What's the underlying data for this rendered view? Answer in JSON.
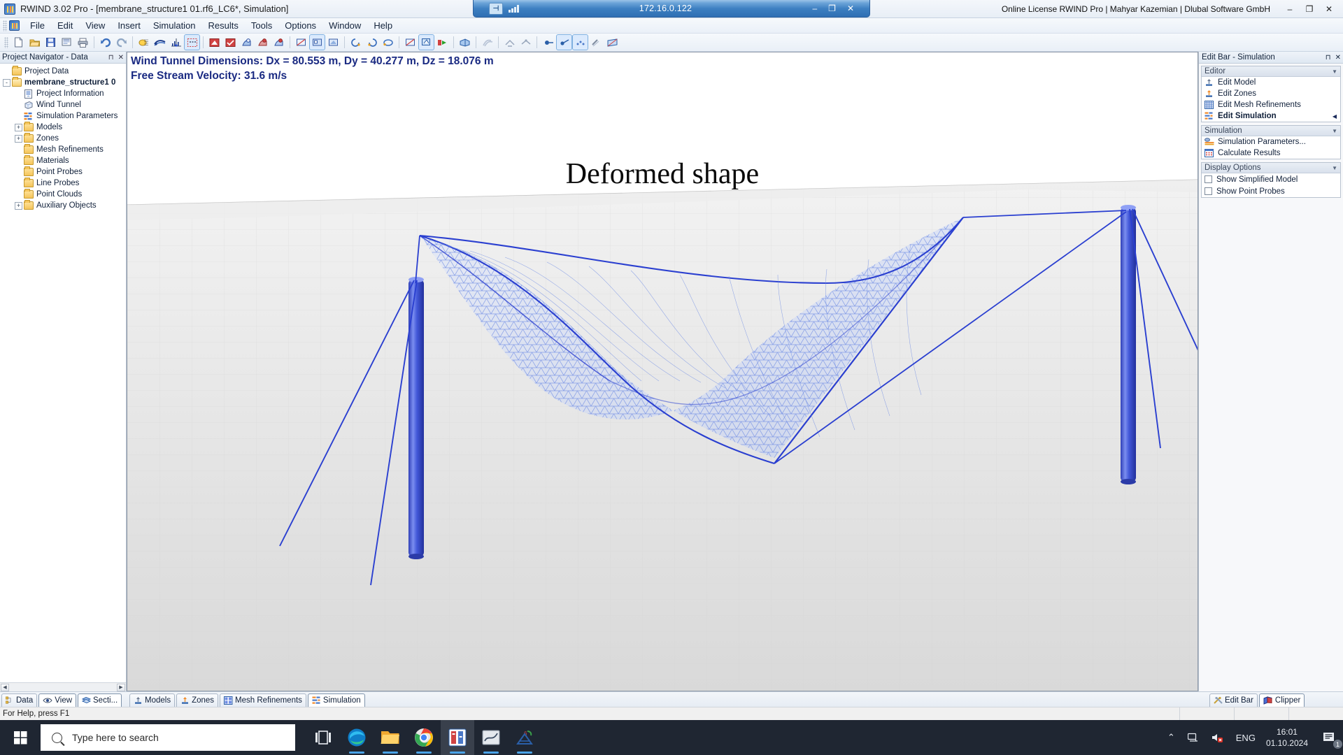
{
  "rdp": {
    "address": "172.16.0.122",
    "pin_icon": "pin-icon",
    "signal_icon": "signal-bars-icon",
    "minimize": "–",
    "restore": "❐",
    "close": "✕"
  },
  "titlebar": {
    "app_icon": "rwind-app-icon",
    "title": "RWIND 3.02 Pro - [membrane_structure1 01.rf6_LC6*, Simulation]",
    "license": "Online License RWIND Pro | Mahyar Kazemian | Dlubal Software GmbH",
    "minimize": "–",
    "restore": "❐",
    "close": "✕"
  },
  "menubar": {
    "items": [
      {
        "label": "File"
      },
      {
        "label": "Edit"
      },
      {
        "label": "View"
      },
      {
        "label": "Insert"
      },
      {
        "label": "Simulation"
      },
      {
        "label": "Results"
      },
      {
        "label": "Tools"
      },
      {
        "label": "Options"
      },
      {
        "label": "Window"
      },
      {
        "label": "Help"
      }
    ]
  },
  "toolbar": {
    "groups": [
      {
        "icons": [
          "new-file-icon",
          "open-folder-icon",
          "save-icon",
          "save-as-icon",
          "print-icon"
        ]
      },
      {
        "icons": [
          "undo-icon",
          "redo-icon"
        ]
      },
      {
        "icons": [
          "mesh-generate-icon",
          "wind-tunnel-icon",
          "axes-icon",
          "selection-box-icon"
        ]
      },
      {
        "icons": [
          "model-view-icon",
          "zones-view-icon",
          "results-view-icon",
          "results-red-icon",
          "results-blue-icon"
        ]
      },
      {
        "icons": [
          "render-wire-icon",
          "render-solid-icon",
          "render-shaded-icon"
        ]
      },
      {
        "icons": [
          "rotate-left-icon",
          "rotate-right-icon",
          "rotate-3d-icon"
        ]
      },
      {
        "icons": [
          "zoom-window-icon",
          "zoom-fit-icon",
          "run-simulation-icon"
        ]
      },
      {
        "icons": [
          "clipper-icon"
        ]
      },
      {
        "icons": [
          "streamlines-icon"
        ]
      },
      {
        "icons": [
          "isosurface-icon",
          "section-plane-icon"
        ]
      },
      {
        "icons": [
          "probe-point-icon",
          "probe-line-icon",
          "probe-cloud-icon",
          "measure-icon",
          "deform-icon"
        ]
      }
    ]
  },
  "navigator": {
    "title": "Project Navigator - Data",
    "pin_icon": "pin-icon",
    "close_icon": "close-icon",
    "tree": [
      {
        "label": "Project Data",
        "depth": 0,
        "expander": "",
        "icon": "folder-icon",
        "bold": false
      },
      {
        "label": "membrane_structure1 0",
        "depth": 0,
        "expander": "-",
        "icon": "folder-open-icon",
        "bold": true
      },
      {
        "label": "Project Information",
        "depth": 1,
        "expander": "",
        "icon": "document-info-icon",
        "bold": false
      },
      {
        "label": "Wind Tunnel",
        "depth": 1,
        "expander": "",
        "icon": "wind-tunnel-icon",
        "bold": false
      },
      {
        "label": "Simulation Parameters",
        "depth": 1,
        "expander": "",
        "icon": "simulation-params-icon",
        "bold": false
      },
      {
        "label": "Models",
        "depth": 1,
        "expander": "+",
        "icon": "folder-icon",
        "bold": false
      },
      {
        "label": "Zones",
        "depth": 1,
        "expander": "+",
        "icon": "folder-icon",
        "bold": false
      },
      {
        "label": "Mesh Refinements",
        "depth": 1,
        "expander": "",
        "icon": "folder-icon",
        "bold": false
      },
      {
        "label": "Materials",
        "depth": 1,
        "expander": "",
        "icon": "folder-icon",
        "bold": false
      },
      {
        "label": "Point Probes",
        "depth": 1,
        "expander": "",
        "icon": "folder-icon",
        "bold": false
      },
      {
        "label": "Line Probes",
        "depth": 1,
        "expander": "",
        "icon": "folder-icon",
        "bold": false
      },
      {
        "label": "Point Clouds",
        "depth": 1,
        "expander": "",
        "icon": "folder-icon",
        "bold": false
      },
      {
        "label": "Auxiliary Objects",
        "depth": 1,
        "expander": "+",
        "icon": "folder-icon",
        "bold": false
      }
    ],
    "tabs": [
      {
        "label": "Data",
        "icon": "data-tree-icon",
        "selected": false
      },
      {
        "label": "View",
        "icon": "eye-icon",
        "selected": true
      },
      {
        "label": "Secti...",
        "icon": "sections-icon",
        "selected": true
      }
    ]
  },
  "viewport": {
    "info_line1": "Wind Tunnel Dimensions: Dx = 80.553 m, Dy = 40.277 m, Dz = 18.076 m",
    "info_line2": "Free Stream Velocity: 31.6 m/s",
    "title": "Deformed shape",
    "info_color": "#1a2a82",
    "structure_color": "#3b4fd8",
    "mesh_color": "#5d7ce0",
    "ground_color": "#e2e2e2",
    "tabs": [
      {
        "label": "Models",
        "icon": "models-icon",
        "selected": false
      },
      {
        "label": "Zones",
        "icon": "zones-icon",
        "selected": false
      },
      {
        "label": "Mesh Refinements",
        "icon": "mesh-refinements-icon",
        "selected": false
      },
      {
        "label": "Simulation",
        "icon": "simulation-icon",
        "selected": true
      }
    ]
  },
  "editbar": {
    "title": "Edit Bar - Simulation",
    "pin_icon": "pin-icon",
    "close_icon": "close-icon",
    "groups": [
      {
        "title": "Editor",
        "chevron": "▼",
        "items": [
          {
            "label": "Edit Model",
            "icon": "edit-model-icon",
            "bold": false,
            "arrow": ""
          },
          {
            "label": "Edit Zones",
            "icon": "edit-zones-icon",
            "bold": false,
            "arrow": ""
          },
          {
            "label": "Edit Mesh Refinements",
            "icon": "edit-mesh-icon",
            "bold": false,
            "arrow": ""
          },
          {
            "label": "Edit Simulation",
            "icon": "edit-simulation-icon",
            "bold": true,
            "arrow": "◀"
          }
        ]
      },
      {
        "title": "Simulation",
        "chevron": "▼",
        "items": [
          {
            "label": "Simulation Parameters...",
            "icon": "simulation-parameters-icon",
            "bold": false,
            "arrow": ""
          },
          {
            "label": "Calculate Results",
            "icon": "calculate-results-icon",
            "bold": false,
            "arrow": ""
          }
        ]
      }
    ],
    "display_options": {
      "title": "Display Options",
      "chevron": "▼",
      "checkboxes": [
        {
          "label": "Show Simplified Model",
          "checked": false
        },
        {
          "label": "Show Point Probes",
          "checked": false
        }
      ]
    },
    "tabs": [
      {
        "label": "Edit Bar",
        "icon": "tools-icon",
        "selected": false
      },
      {
        "label": "Clipper",
        "icon": "clipper-icon",
        "selected": true
      }
    ]
  },
  "statusbar": {
    "hint": "For Help, press F1"
  },
  "taskbar": {
    "start_icon": "windows-start-icon",
    "search_placeholder": "Type here to search",
    "search_icon": "search-icon",
    "apps": [
      {
        "name": "task-view-icon"
      },
      {
        "name": "microsoft-edge-icon"
      },
      {
        "name": "file-explorer-icon"
      },
      {
        "name": "google-chrome-icon"
      },
      {
        "name": "rwind-taskbar-icon"
      },
      {
        "name": "rfem-results-icon"
      },
      {
        "name": "rfem-icon"
      }
    ],
    "tray": {
      "chevron": "⌃",
      "network_icon": "network-icon",
      "volume_icon": "volume-muted-icon",
      "language": "ENG",
      "time": "16:01",
      "date": "01.10.2024",
      "notifications_icon": "notifications-icon",
      "notification_count": "1"
    }
  }
}
